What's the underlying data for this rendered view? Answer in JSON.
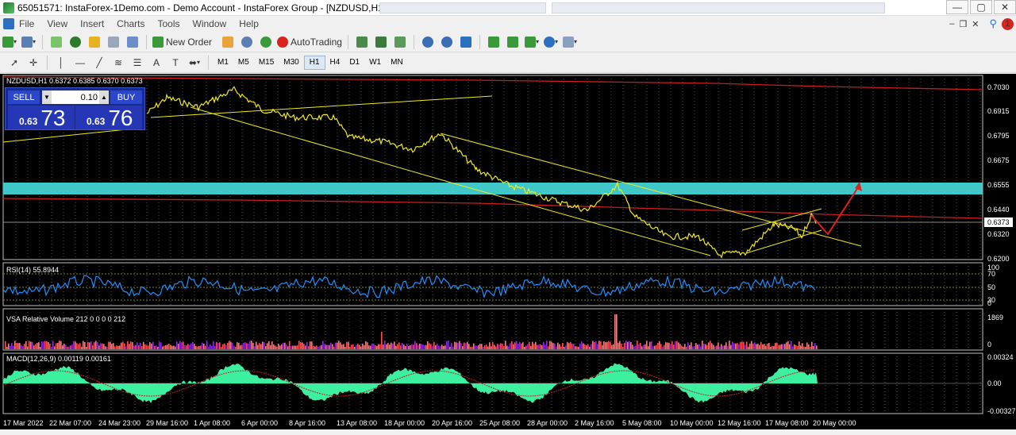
{
  "window": {
    "title": "65051571: InstaForex-1Demo.com - Demo Account - InstaForex Group - [NZDUSD,H1]",
    "buttons": [
      "—",
      "▢",
      "✕"
    ]
  },
  "menu": {
    "items": [
      "File",
      "View",
      "Insert",
      "Charts",
      "Tools",
      "Window",
      "Help"
    ],
    "notification_count": "1"
  },
  "toolbar": {
    "new_order_label": "New Order",
    "autotrading_label": "AutoTrading"
  },
  "timeframes": [
    "M1",
    "M5",
    "M15",
    "M30",
    "H1",
    "H4",
    "D1",
    "W1",
    "MN"
  ],
  "active_timeframe": "H1",
  "chart": {
    "symbol_info": "NZDUSD,H1  0.6372 0.6385 0.6370 0.6373",
    "price_labels": [
      "0.7030",
      "0.6915",
      "0.6795",
      "0.6675",
      "0.6555",
      "0.6440",
      "0.6320",
      "0.6200"
    ],
    "current_price": "0.6373",
    "rsi_label": "RSI(14) 55.8944",
    "rsi_levels": [
      "100",
      "70",
      "50",
      "30",
      "0"
    ],
    "vsa_label": "VSA Relative Volume 212 0 0 0 0 212",
    "vsa_levels": [
      "1869",
      "0"
    ],
    "macd_label": "MACD(12,26,9) 0.00119 0.00161",
    "macd_levels": [
      "0.00324",
      "0.00",
      "-0.00327"
    ],
    "time_labels": [
      "17 Mar 2022",
      "22 Mar 07:00",
      "24 Mar 23:00",
      "29 Mar 16:00",
      "1 Apr 08:00",
      "6 Apr 00:00",
      "8 Apr 16:00",
      "13 Apr 08:00",
      "18 Apr 00:00",
      "20 Apr 16:00",
      "25 Apr 08:00",
      "28 Apr 00:00",
      "2 May 16:00",
      "5 May 08:00",
      "10 May 00:00",
      "12 May 16:00",
      "17 May 08:00",
      "20 May 00:00"
    ]
  },
  "trade_panel": {
    "sell_label": "SELL",
    "buy_label": "BUY",
    "lot": "0.10",
    "bid_small": "0.63",
    "bid_big": "73",
    "ask_small": "0.63",
    "ask_big": "76"
  },
  "colors": {
    "price_line": "#f2ea1c",
    "rsi_line": "#1e90ff",
    "macd_hist": "#3cf0a0",
    "zone": "#40c8c8",
    "arrow": "#e02020"
  }
}
